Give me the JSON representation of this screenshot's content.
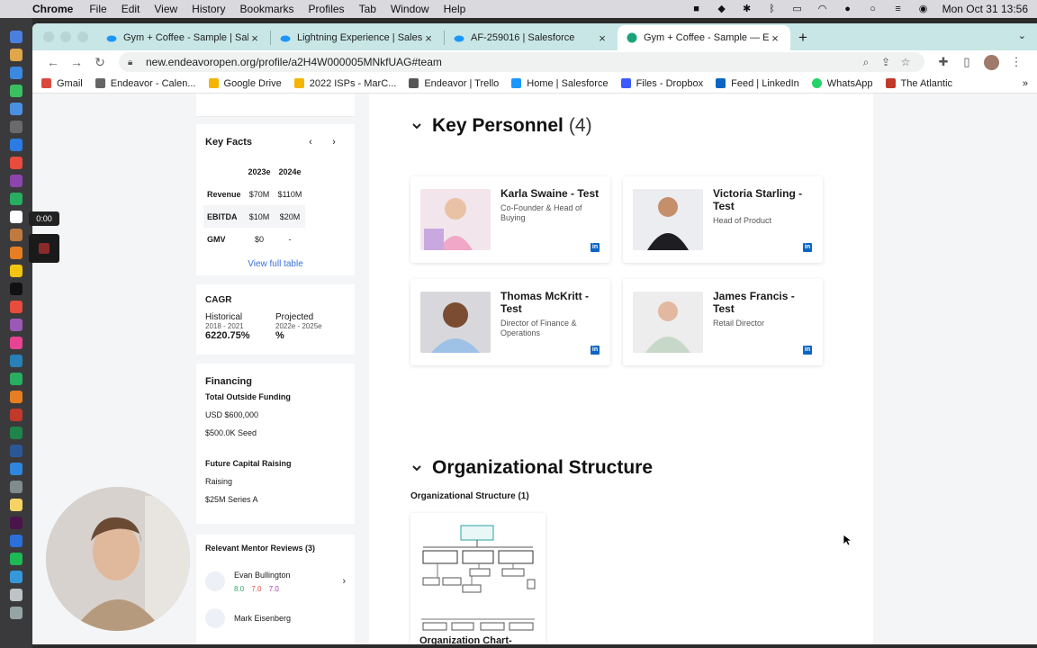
{
  "menubar": {
    "items": [
      "Chrome",
      "File",
      "Edit",
      "View",
      "History",
      "Bookmarks",
      "Profiles",
      "Tab",
      "Window",
      "Help"
    ],
    "clock": "Mon Oct 31  13:56"
  },
  "tabs": [
    {
      "title": "Gym + Coffee - Sample | Salesforce",
      "color": "#1b96ff"
    },
    {
      "title": "Lightning Experience | Salesforce",
      "color": "#1b96ff"
    },
    {
      "title": "AF-259016 | Salesforce",
      "color": "#1b96ff"
    },
    {
      "title": "Gym + Coffee - Sample — Endeavor",
      "color": "#1aa37a"
    }
  ],
  "address": {
    "url": "new.endeavoropen.org/profile/a2H4W000005MNkfUAG#team"
  },
  "bookmarks": [
    {
      "label": "Gmail",
      "color": "#d94a3d"
    },
    {
      "label": "Endeavor - Calen...",
      "color": "#666666"
    },
    {
      "label": "Google Drive",
      "color": "#f4b400"
    },
    {
      "label": "2022 ISPs - MarC...",
      "color": "#f4b400"
    },
    {
      "label": "Endeavor | Trello",
      "color": "#555555"
    },
    {
      "label": "Home | Salesforce",
      "color": "#1b96ff"
    },
    {
      "label": "Files - Dropbox",
      "color": "#3d5afe"
    },
    {
      "label": "Feed | LinkedIn",
      "color": "#0a66c2"
    },
    {
      "label": "WhatsApp",
      "color": "#25d366"
    },
    {
      "label": "The Atlantic",
      "color": "#c0392b"
    }
  ],
  "recorder": {
    "time": "0:00"
  },
  "key_facts": {
    "title": "Key Facts",
    "columns": [
      "2023e",
      "2024e"
    ],
    "rows": [
      {
        "label": "Revenue",
        "values": [
          "$70M",
          "$110M"
        ]
      },
      {
        "label": "EBITDA",
        "values": [
          "$10M",
          "$20M"
        ]
      },
      {
        "label": "GMV",
        "values": [
          "$0",
          "-"
        ]
      }
    ],
    "link": "View full table"
  },
  "cagr": {
    "title": "CAGR",
    "historical_label": "Historical",
    "historical_range": "2018 - 2021",
    "historical_value": "6220.75%",
    "projected_label": "Projected",
    "projected_range": "2022e - 2025e",
    "projected_value": "%"
  },
  "financing": {
    "title": "Financing",
    "outside_label": "Total Outside Funding",
    "outside_amount": "USD $600,000",
    "outside_round": "$500.0K Seed",
    "future_label": "Future Capital Raising",
    "future_status": "Raising",
    "future_round": "$25M Series A"
  },
  "mentor_reviews": {
    "title": "Relevant Mentor Reviews (3)",
    "reviews": [
      {
        "name": "Evan Bullington",
        "scores": [
          "8.0",
          "7.0",
          "7.0"
        ]
      },
      {
        "name": "Mark Eisenberg"
      }
    ]
  },
  "personnel": {
    "title": "Key Personnel",
    "count": "(4)",
    "people": [
      {
        "name": "Karla Swaine - Test",
        "role": "Co-Founder & Head of Buying"
      },
      {
        "name": "Victoria Starling - Test",
        "role": "Head of Product"
      },
      {
        "name": "Thomas McKritt - Test",
        "role": "Director of Finance & Operations"
      },
      {
        "name": "James Francis - Test",
        "role": "Retail Director"
      }
    ]
  },
  "org": {
    "title": "Organizational Structure",
    "subtitle": "Organizational Structure (1)",
    "chart_title": "Organization Chart-"
  },
  "colors": {
    "accent": "#3a6fd8",
    "linkedin": "#0a66c2",
    "tabstrip": "#c8e6e6"
  }
}
